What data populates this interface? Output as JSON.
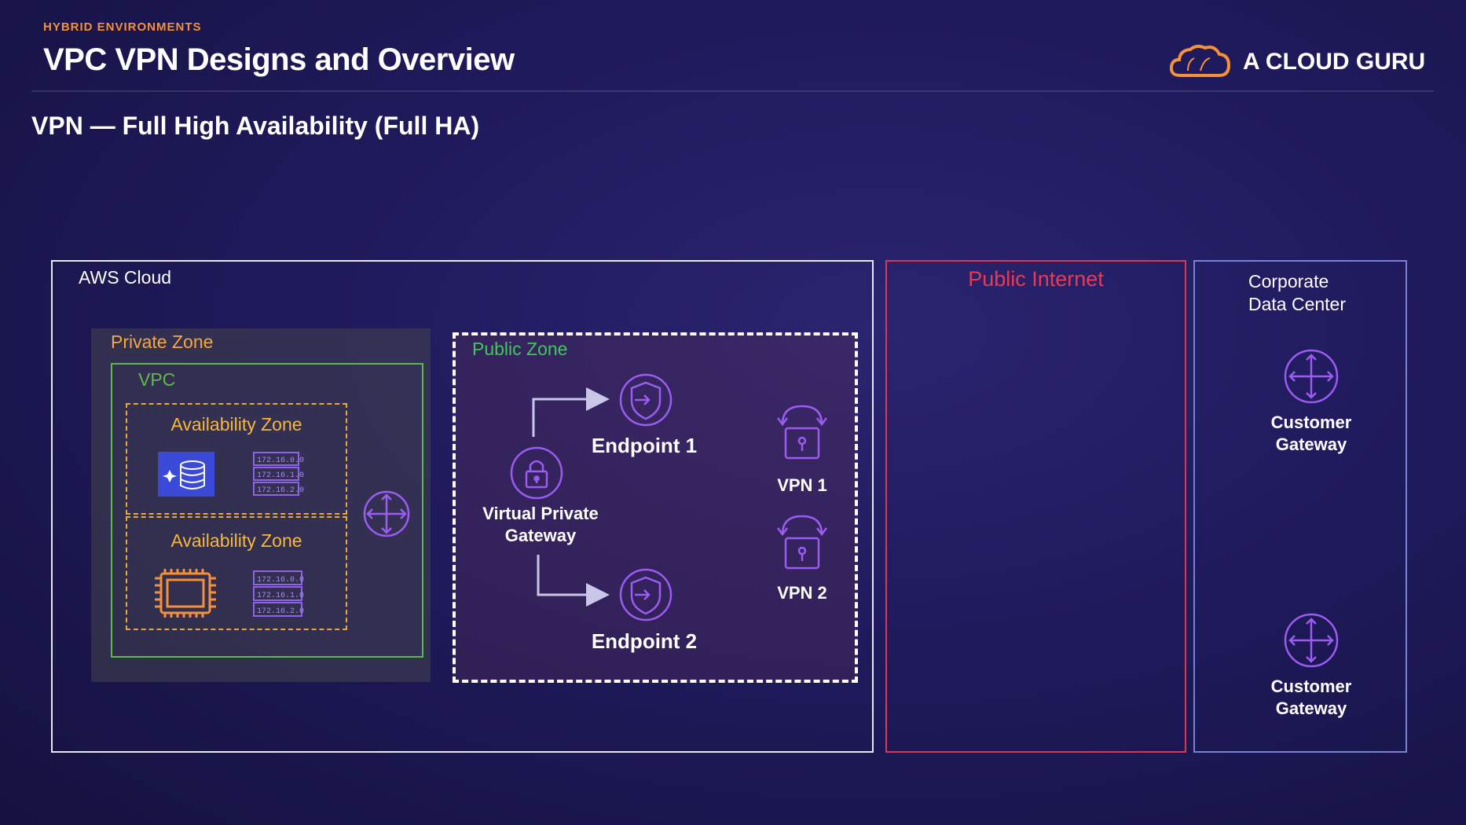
{
  "header": {
    "kicker": "HYBRID ENVIRONMENTS",
    "title": "VPC VPN Designs and Overview",
    "brand": "A CLOUD GURU",
    "subtitle": "VPN — Full High Availability (Full HA)"
  },
  "diagram": {
    "aws_cloud": "AWS Cloud",
    "public_internet": "Public Internet",
    "corporate_dc": [
      "Corporate",
      "Data Center"
    ],
    "private_zone": "Private Zone",
    "vpc": "VPC",
    "availability_zone_1": "Availability Zone",
    "availability_zone_2": "Availability Zone",
    "public_zone": "Public Zone",
    "subnet_cidrs": [
      "172.16.0.0",
      "172.16.1.0",
      "172.16.2.0"
    ],
    "endpoint_1": "Endpoint 1",
    "endpoint_2": "Endpoint 2",
    "vgw": [
      "Virtual Private",
      "Gateway"
    ],
    "vpn_1": "VPN 1",
    "vpn_2": "VPN 2",
    "customer_gateway_1": [
      "Customer",
      "Gateway"
    ],
    "customer_gateway_2": [
      "Customer",
      "Gateway"
    ]
  },
  "colors": {
    "brand_orange": "#f5903b",
    "aws_border": "#e9e6f5",
    "internet_red": "#e0354f",
    "corp_blue": "#7b7fd6",
    "vpc_green": "#5fb94a",
    "az_amber": "#e7a93a",
    "icon_purple": "#9b5cf0"
  }
}
